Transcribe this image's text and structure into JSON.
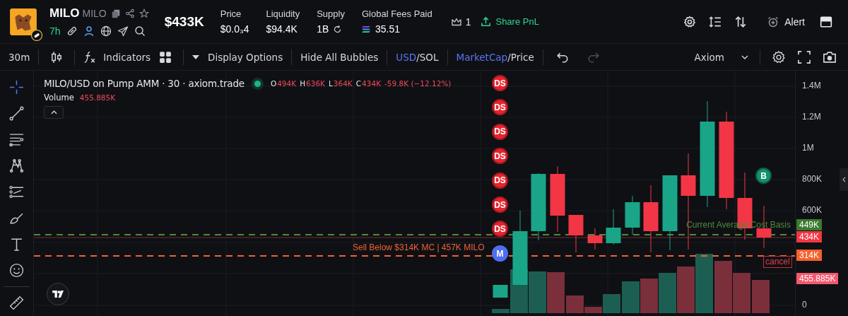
{
  "token": {
    "name": "MILO",
    "ticker": "MILO",
    "age": "7h"
  },
  "market_cap": "$433K",
  "stats": [
    {
      "label": "Price",
      "value": "$0.0₃4",
      "kind": "plain"
    },
    {
      "label": "Liquidity",
      "value": "$94.4K",
      "kind": "plain"
    },
    {
      "label": "Supply",
      "value": "1B",
      "kind": "supply"
    },
    {
      "label": "Global Fees Paid",
      "value": "35.51",
      "kind": "sol"
    }
  ],
  "holders_count": "1",
  "share_button": "Share PnL",
  "alert_button": "Alert",
  "toolbar": {
    "interval": "30m",
    "indicators": "Indicators",
    "display_options": "Display Options",
    "hide_bubbles": "Hide All Bubbles",
    "toggles": [
      {
        "separator": "/",
        "options": [
          {
            "label": "USD",
            "selected": true
          },
          {
            "label": "SOL",
            "selected": false
          }
        ]
      },
      {
        "separator": "/",
        "options": [
          {
            "label": "MarketCap",
            "selected": true
          },
          {
            "label": "Price",
            "selected": false
          }
        ]
      }
    ],
    "layout_name": "Axiom"
  },
  "legend": {
    "title": "MILO/USD on Pump AMM · 30 · axiom.trade",
    "ohlc": [
      {
        "key": "O",
        "value": "494K"
      },
      {
        "key": "H",
        "value": "636K"
      },
      {
        "key": "L",
        "value": "364K"
      },
      {
        "key": "C",
        "value": "434K"
      }
    ],
    "change": "-59.8K (−12.12%)",
    "volume_label": "Volume",
    "volume_value": "455.885K"
  },
  "markers": [
    {
      "label": "DS",
      "kind": "ds"
    },
    {
      "label": "DS",
      "kind": "ds"
    },
    {
      "label": "DS",
      "kind": "ds"
    },
    {
      "label": "DS",
      "kind": "ds"
    },
    {
      "label": "DS",
      "kind": "ds"
    },
    {
      "label": "DS",
      "kind": "ds"
    },
    {
      "label": "DS",
      "kind": "ds"
    },
    {
      "label": "M",
      "kind": "m"
    }
  ],
  "buy_marker": "B",
  "cost_basis_label": "Current Average Cost Basis",
  "sell_label": "Sell Below $314K MC | 457K MILO",
  "cancel_button": "cancel",
  "axis_labels": [
    "1.4M",
    "1.2M",
    "1M",
    "800K",
    "600K",
    "0"
  ],
  "axis_tags": [
    {
      "label": "449K",
      "color": "#3b7a2f"
    },
    {
      "label": "434K",
      "color": "#f23645"
    },
    {
      "label": "314K",
      "color": "#f4622b"
    },
    {
      "label": "455.885K",
      "color": "#f25a6e"
    }
  ]
}
